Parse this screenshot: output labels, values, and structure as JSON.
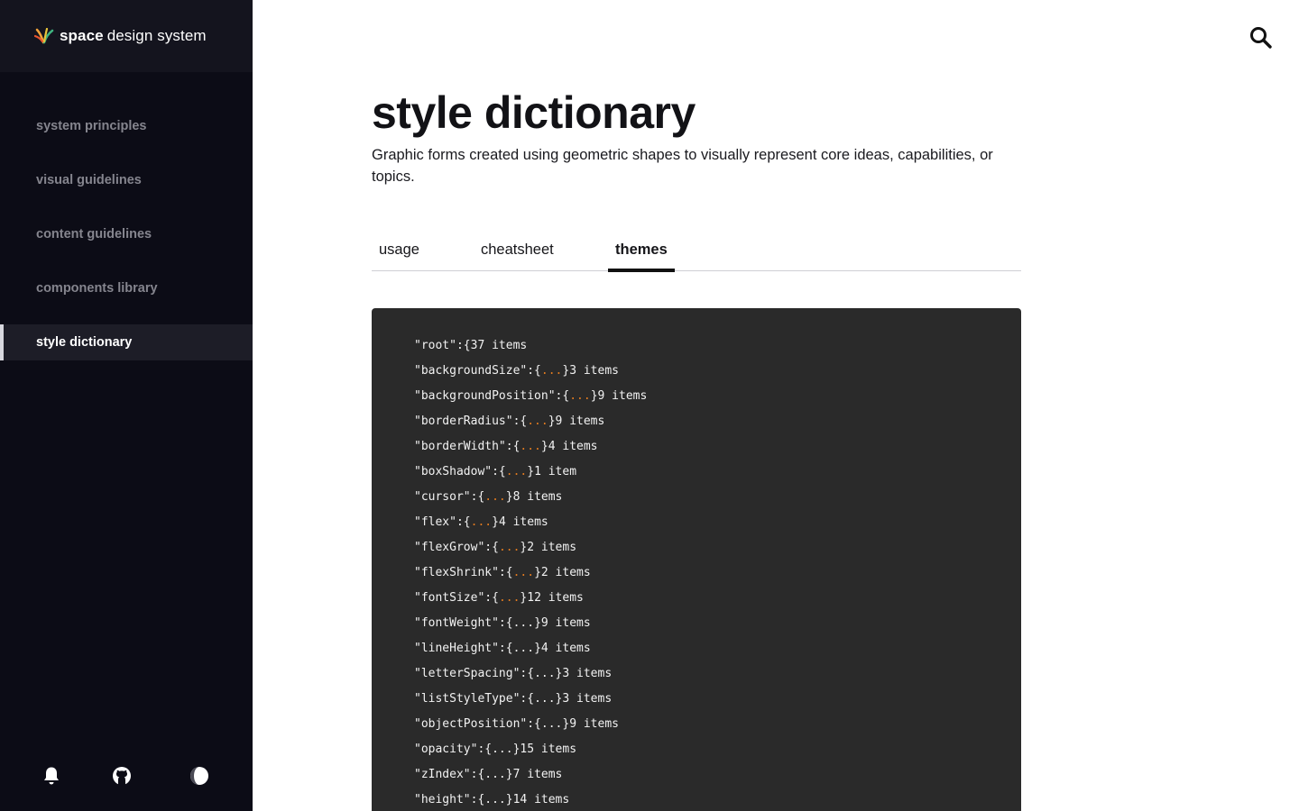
{
  "brand": {
    "strong": "space",
    "rest": "design system"
  },
  "nav": [
    {
      "label": "system principles",
      "active": false
    },
    {
      "label": "visual guidelines",
      "active": false
    },
    {
      "label": "content guidelines",
      "active": false
    },
    {
      "label": "components library",
      "active": false
    },
    {
      "label": "style dictionary",
      "active": true
    }
  ],
  "footer_icons": [
    "bell-icon",
    "github-icon",
    "theme-toggle-icon"
  ],
  "page": {
    "title": "style dictionary",
    "description": "Graphic forms created using geometric shapes to visually represent core ideas, capabilities, or topics."
  },
  "tabs": [
    {
      "label": "usage",
      "active": false
    },
    {
      "label": "cheatsheet",
      "active": false
    },
    {
      "label": "themes",
      "active": true
    }
  ],
  "colors": {
    "sidebar_bg": "#0c0c16",
    "code_bg": "#2a2a2a",
    "accent": "#e07a1f"
  },
  "code": {
    "root_key": "\"root\"",
    "root_suffix": "{37 items",
    "lines": [
      {
        "key": "\"backgroundSize\"",
        "count": "3 items",
        "accent": true
      },
      {
        "key": "\"backgroundPosition\"",
        "count": "9 items",
        "accent": true
      },
      {
        "key": "\"borderRadius\"",
        "count": "9 items",
        "accent": true
      },
      {
        "key": "\"borderWidth\"",
        "count": "4 items",
        "accent": true
      },
      {
        "key": "\"boxShadow\"",
        "count": "1 item",
        "accent": true
      },
      {
        "key": "\"cursor\"",
        "count": "8 items",
        "accent": true
      },
      {
        "key": "\"flex\"",
        "count": "4 items",
        "accent": true
      },
      {
        "key": "\"flexGrow\"",
        "count": "2 items",
        "accent": true
      },
      {
        "key": "\"flexShrink\"",
        "count": "2 items",
        "accent": true
      },
      {
        "key": "\"fontSize\"",
        "count": "12 items",
        "accent": true
      },
      {
        "key": "\"fontWeight\"",
        "count": "9 items",
        "accent": false
      },
      {
        "key": "\"lineHeight\"",
        "count": "4 items",
        "accent": false
      },
      {
        "key": "\"letterSpacing\"",
        "count": "3 items",
        "accent": false
      },
      {
        "key": "\"listStyleType\"",
        "count": "3 items",
        "accent": false
      },
      {
        "key": "\"objectPosition\"",
        "count": "9 items",
        "accent": false
      },
      {
        "key": "\"opacity\"",
        "count": "15 items",
        "accent": false
      },
      {
        "key": "\"zIndex\"",
        "count": "7 items",
        "accent": false
      },
      {
        "key": "\"height\"",
        "count": "14 items",
        "accent": false
      }
    ]
  }
}
